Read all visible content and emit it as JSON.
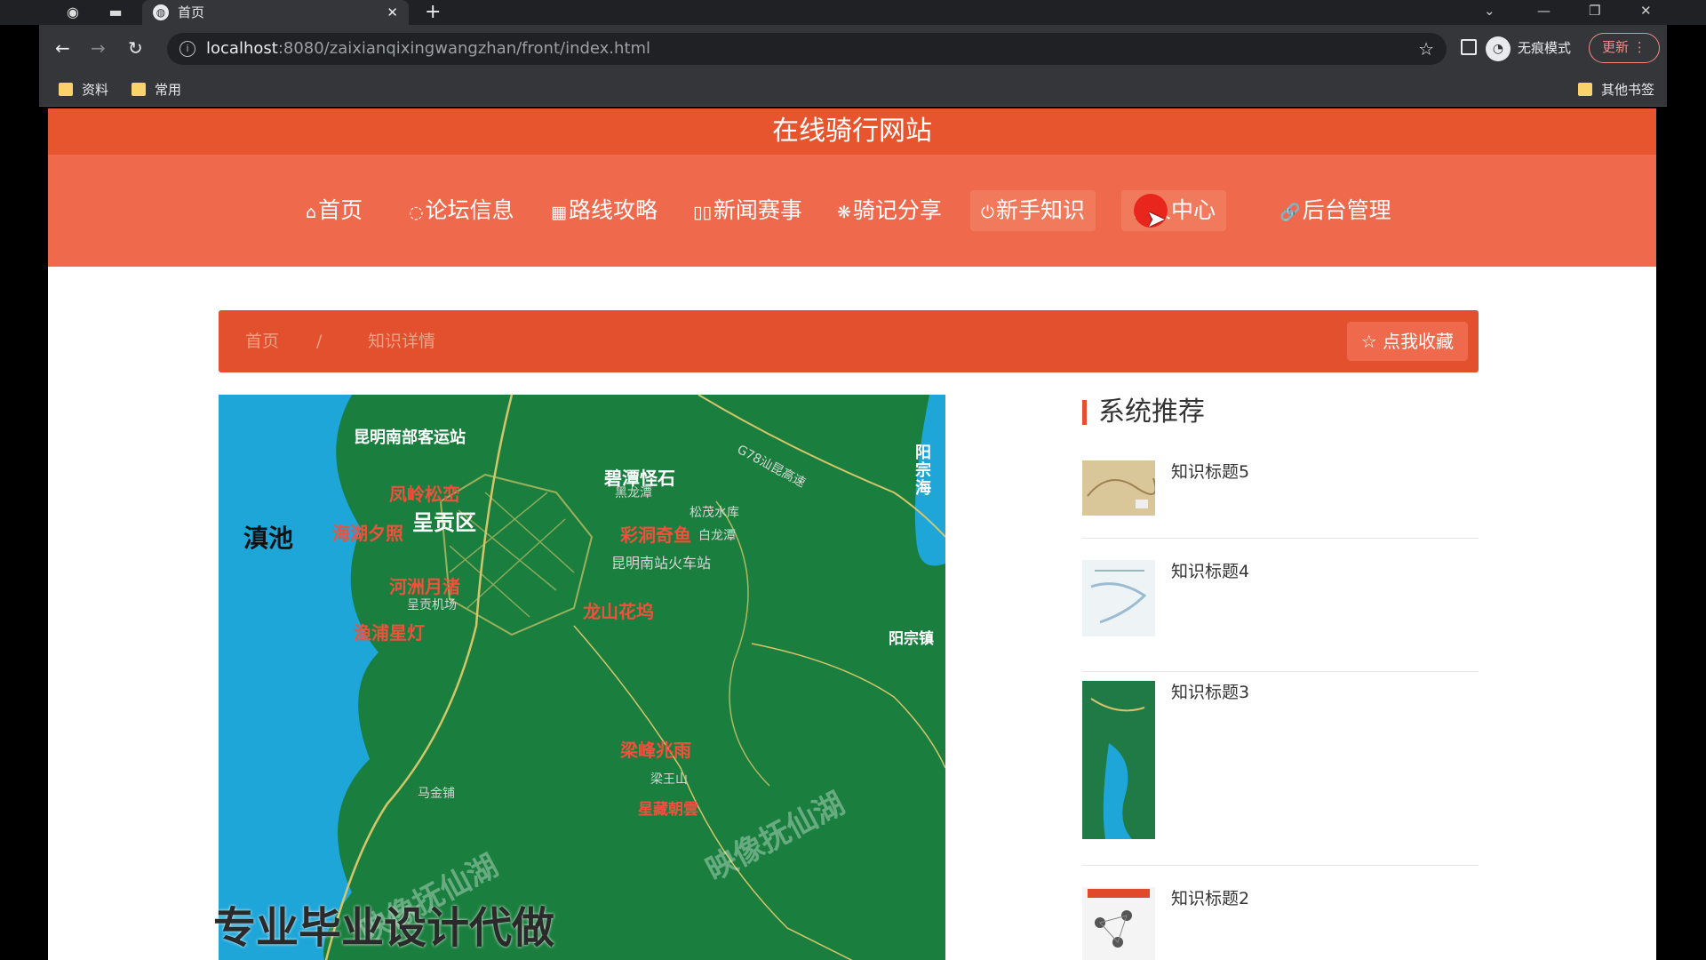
{
  "browser": {
    "tab_title": "首页",
    "url_host": "localhost",
    "url_path": ":8080/zaixianqixingwangzhan/front/index.html",
    "incognito_label": "无痕模式",
    "update_label": "更新",
    "bookmarks": [
      "资料",
      "常用"
    ],
    "other_bookmarks": "其他书签"
  },
  "site": {
    "title": "在线骑行网站",
    "nav": [
      {
        "icon": "⌂",
        "label": "首页"
      },
      {
        "icon": "◌",
        "label": "论坛信息"
      },
      {
        "icon": "▦",
        "label": "路线攻略"
      },
      {
        "icon": "▯▯",
        "label": "新闻赛事"
      },
      {
        "icon": "❋",
        "label": "骑记分享"
      },
      {
        "icon": "⏻",
        "label": "新手知识"
      },
      {
        "icon": "♙",
        "label": "人中心"
      },
      {
        "icon": "🔗",
        "label": "后台管理"
      }
    ],
    "active_nav_index": 5,
    "accent_color": "#ef6a4c",
    "header_dark_color": "#e7552f"
  },
  "breadcrumb": {
    "home": "首页",
    "separator": "/",
    "current": "知识详情",
    "favorite_button": "点我收藏"
  },
  "map_image": {
    "labels_dark": [
      "滇池"
    ],
    "labels_white": [
      "昆明南部客运站",
      "呈贡区",
      "碧潭怪石",
      "阳宗镇",
      "阳宗海"
    ],
    "labels_red": [
      "凤岭松峦",
      "海湖夕照",
      "河洲月渚",
      "渔浦星灯",
      "彩洞奇鱼",
      "龙山花坞",
      "梁峰兆雨",
      "黑龙潭",
      "白龙潭",
      "昆明南站火车站",
      "梁王山",
      "星藏朝雲",
      "马金铺",
      "G78汕昆高速",
      "呈贡机场",
      "松茂水库"
    ],
    "watermark_main": "专业毕业设计代做",
    "watermark_faint": "映像抚仙湖"
  },
  "recommend": {
    "title": "系统推荐",
    "items": [
      {
        "label": "知识标题5"
      },
      {
        "label": "知识标题4"
      },
      {
        "label": "知识标题3"
      },
      {
        "label": "知识标题2"
      }
    ]
  }
}
